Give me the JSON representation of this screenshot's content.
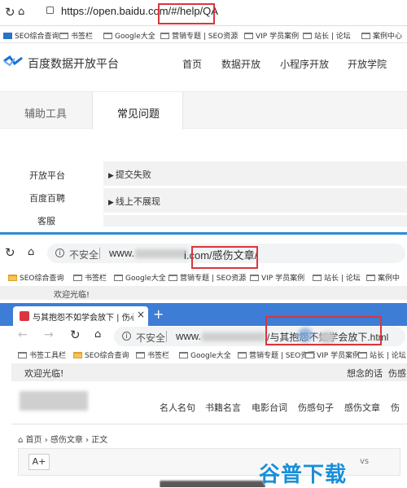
{
  "top_browser": {
    "url": "https://open.baidu.com/#/help/QA",
    "bookmarks": [
      "SEO综合查询",
      "书签栏",
      "Google大全",
      "营销专题 | SEO资源",
      "VIP 学员案例",
      "站长 | 论坛",
      "案例中心"
    ]
  },
  "baidu_site": {
    "title": "百度数据开放平台",
    "nav": [
      "首页",
      "数据开放",
      "小程序开放",
      "开放学院"
    ],
    "tabs": [
      "辅助工具",
      "常见问题"
    ],
    "sidebar": [
      "开放平台",
      "百度百聘",
      "客服"
    ],
    "faq": [
      "提交失败",
      "线上不展现"
    ]
  },
  "second_browser": {
    "insecure_label": "不安全",
    "url_prefix": "www.",
    "url_mid": "i.com/感伤文章/",
    "bookmarks": [
      "SEO综合查询",
      "书签栏",
      "Google大全",
      "营销专题 | SEO资源",
      "VIP 学员案例",
      "站长 | 论坛",
      "案例中"
    ],
    "welcome": "欢迎光临!"
  },
  "third_browser": {
    "tab_title": "与其抱怨不如学会放下 | 伤心的",
    "insecure_label": "不安全",
    "url_prefix": "www.",
    "url_suffix": "/与其抱怨不如学会放下.html",
    "bookmarks": [
      "书签工具栏",
      "SEO综合查询",
      "书签栏",
      "Google大全",
      "营销专题 | SEO资源",
      "VIP 学员案例",
      "站长 | 论坛",
      "站"
    ]
  },
  "article_site": {
    "welcome": "欢迎光临!",
    "header_right": "想念的话  伤感",
    "nav": [
      "名人名句",
      "书籍名言",
      "电影台词",
      "伤感句子",
      "感伤文章",
      "伤"
    ],
    "breadcrumb": "首页 › 感伤文章 › 正文",
    "font_button": "A+",
    "share_text": "vs"
  },
  "watermark": "谷普下载",
  "colors": {
    "red_box": "#d9363e",
    "watermark": "#1a8fd8",
    "tab_blue": "#3d7dd6"
  }
}
